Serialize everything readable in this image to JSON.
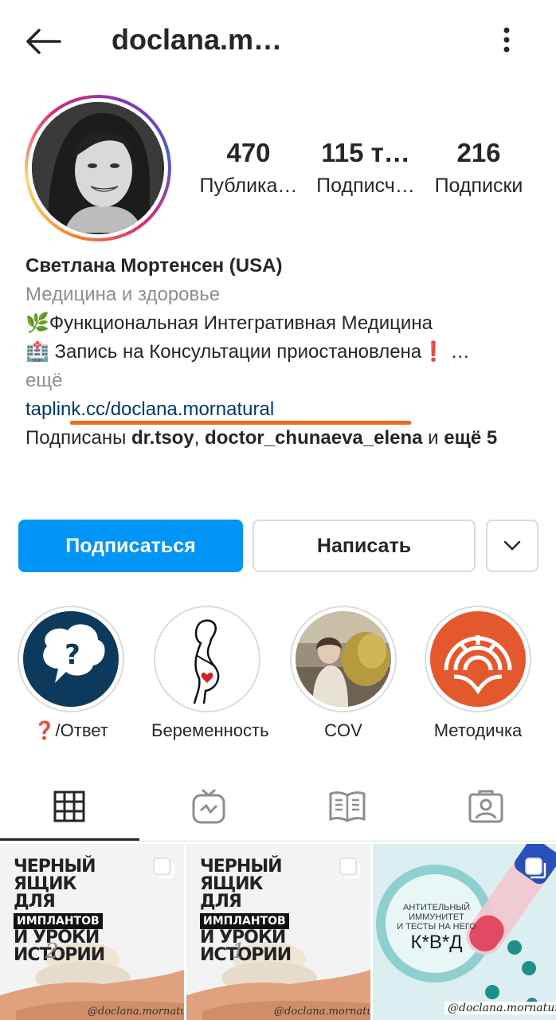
{
  "header": {
    "username": "doclana.m…",
    "back_icon": "arrow-left-icon",
    "more_icon": "kebab-menu-icon"
  },
  "profile": {
    "avatar": "profile-photo",
    "stats": [
      {
        "value": "470",
        "label": "Публика…"
      },
      {
        "value": "115 т…",
        "label": "Подписч…"
      },
      {
        "value": "216",
        "label": "Подписки"
      }
    ]
  },
  "bio": {
    "name": "Светлана Мортенсен (USA)",
    "category": "Медицина и здоровье",
    "line1": "🌿Функциональная Интегративная Медицина",
    "line2": "🏥 Запись на Консультации приостановлена❗ …",
    "more": "ещё",
    "link": "taplink.cc/doclana.mornatural",
    "followed_prefix": "Подписаны ",
    "followed_user1": "dr.tsoy",
    "followed_sep": ", ",
    "followed_user2": "doctor_chunaeva_elena",
    "followed_and": " и ",
    "followed_more": "ещё 5"
  },
  "actions": {
    "follow_label": "Подписаться",
    "message_label": "Написать",
    "dropdown_icon": "chevron-down-icon",
    "follow_color": "#0095f6"
  },
  "highlights": [
    {
      "label": "❓/Ответ"
    },
    {
      "label": "Беременность"
    },
    {
      "label": "COV"
    },
    {
      "label": "Методичка"
    }
  ],
  "tabs": [
    {
      "icon": "grid-icon",
      "active": true
    },
    {
      "icon": "igtv-icon",
      "active": false
    },
    {
      "icon": "guide-icon",
      "active": false
    },
    {
      "icon": "tagged-icon",
      "active": false
    }
  ],
  "posts": [
    {
      "title_top": "ЧЕРНЫЙ ЯЩИК ДЛЯ",
      "title_box": "ИМПЛАНТОВ",
      "title_bottom": "И УРОКИ ИСТОРИИ",
      "number": "2",
      "watermark": "@doclana.mornatural"
    },
    {
      "title_top": "ЧЕРНЫЙ ЯЩИК ДЛЯ",
      "title_box": "ИМПЛАНТОВ",
      "title_bottom": "И УРОКИ ИСТОРИИ",
      "number": "1",
      "watermark": "@doclana.mornatural"
    },
    {
      "line1": "АНТИТЕЛЬНЫЙ",
      "line2": "ИММУНИТЕТ",
      "line3": "И ТЕСТЫ НА НЕГО",
      "headline": "К*В*Д",
      "watermark": "@doclana.mornatural"
    }
  ]
}
